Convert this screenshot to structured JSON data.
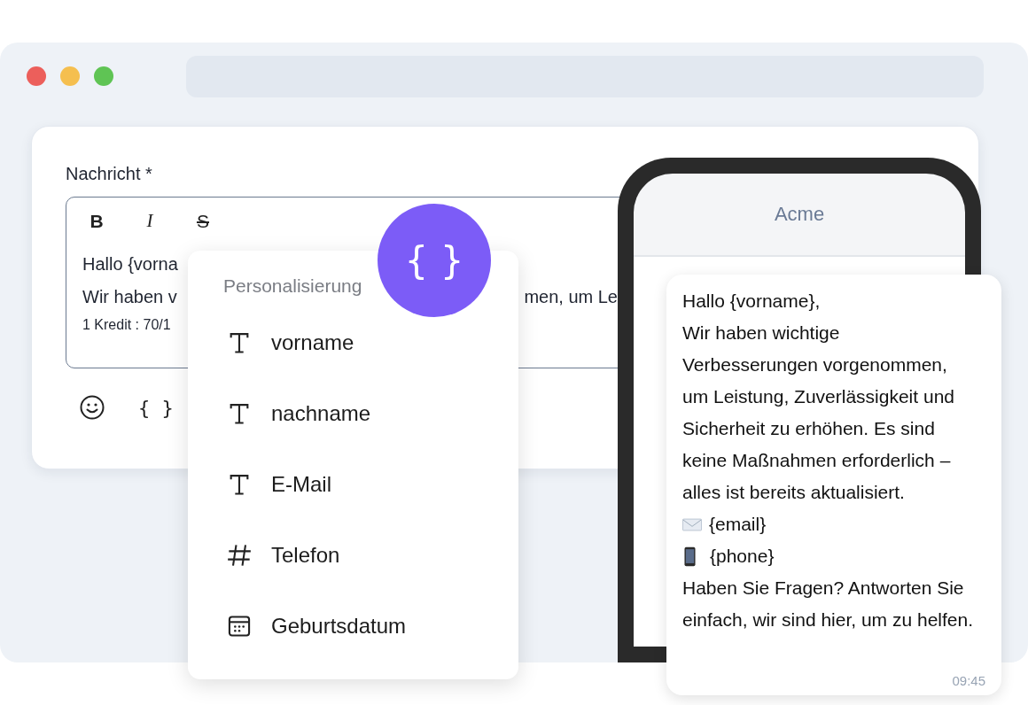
{
  "window": {
    "dots": [
      {
        "color": "#ec5f5b"
      },
      {
        "color": "#f5bf4f"
      },
      {
        "color": "#5fc454"
      }
    ]
  },
  "form": {
    "label": "Nachricht *",
    "toolbar": [
      {
        "kind": "bold",
        "label": "B"
      },
      {
        "kind": "italic",
        "label": "I"
      },
      {
        "kind": "strike",
        "label": "S"
      }
    ],
    "editor_lines": [
      {
        "left": "Hallo {vorna"
      },
      {
        "left": "Wir haben v",
        "right": "men, um Le"
      }
    ],
    "counter": "1 Kredit : 70/1",
    "actions": [
      {
        "kind": "emoji"
      },
      {
        "kind": "variables",
        "label": "{ }"
      }
    ]
  },
  "variable_button": {
    "label": "{ }"
  },
  "menu": {
    "heading": "Personalisierung",
    "items": [
      {
        "kind": "text",
        "label": "vorname"
      },
      {
        "kind": "text",
        "label": "nachname"
      },
      {
        "kind": "text",
        "label": "E-Mail"
      },
      {
        "kind": "number",
        "label": "Telefon"
      },
      {
        "kind": "date",
        "label": "Geburtsdatum"
      }
    ]
  },
  "phone": {
    "title": "Acme",
    "message": [
      {
        "kind": "text",
        "text": "Hallo {vorname},"
      },
      {
        "kind": "text",
        "text": "Wir haben wichtige Verbesserungen vorgenommen, um Leistung, Zuverlässigkeit und Sicherheit zu erhöhen. Es sind keine Maßnahmen erforderlich – alles ist bereits aktualisiert."
      },
      {
        "kind": "email",
        "text": "{email}"
      },
      {
        "kind": "phone",
        "text": "{phone}"
      },
      {
        "kind": "text",
        "text": "Haben Sie Fragen? Antworten Sie einfach, wir sind hier, um zu helfen."
      }
    ],
    "time": "09:45"
  }
}
